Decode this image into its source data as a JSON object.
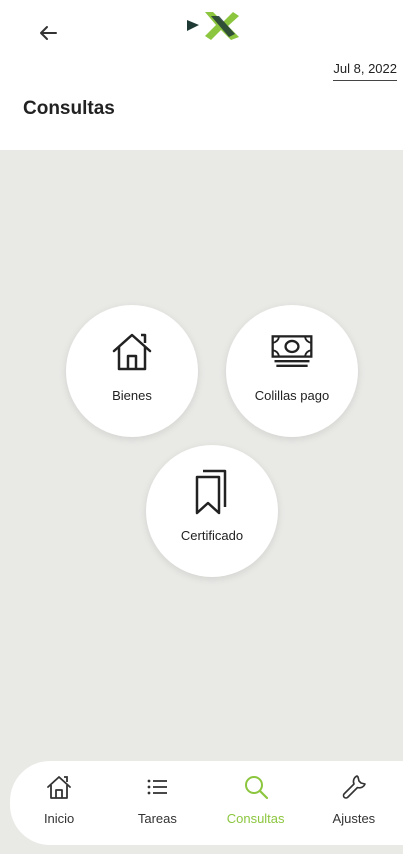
{
  "header": {
    "date": "Jul 8, 2022",
    "title": "Consultas",
    "back_icon": "arrow-left-icon",
    "logo_icon": "brand-logo"
  },
  "options": [
    {
      "label": "Bienes",
      "icon": "house-icon"
    },
    {
      "label": "Colillas pago",
      "icon": "money-icon"
    },
    {
      "label": "Certificado",
      "icon": "bookmarks-icon"
    }
  ],
  "bottom_nav": {
    "items": [
      {
        "label": "Inicio",
        "icon": "home-icon",
        "active": false
      },
      {
        "label": "Tareas",
        "icon": "list-icon",
        "active": false
      },
      {
        "label": "Consultas",
        "icon": "search-icon",
        "active": true
      },
      {
        "label": "Ajustes",
        "icon": "wrench-icon",
        "active": false
      }
    ]
  },
  "colors": {
    "accent": "#8cc63f",
    "logo_dark": "#1f3a35",
    "background": "#e9e9e6"
  }
}
